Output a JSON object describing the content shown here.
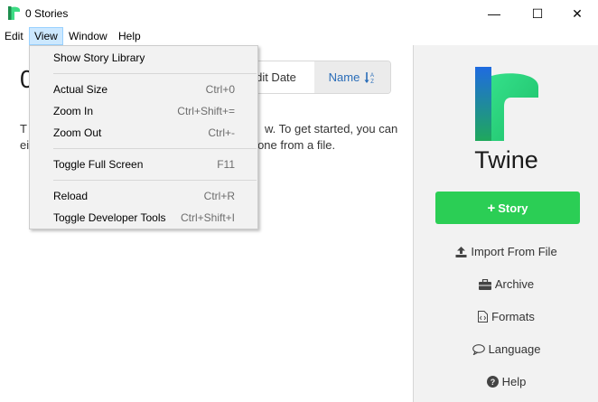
{
  "window": {
    "title": "0 Stories",
    "minimize_glyph": "—",
    "maximize_glyph": "☐",
    "close_glyph": "✕"
  },
  "menubar": {
    "items": [
      "Edit",
      "View",
      "Window",
      "Help"
    ]
  },
  "view_menu": {
    "items": [
      {
        "label": "Show Story Library",
        "accel": ""
      },
      {
        "label": "Actual Size",
        "accel": "Ctrl+0"
      },
      {
        "label": "Zoom In",
        "accel": "Ctrl+Shift+="
      },
      {
        "label": "Zoom Out",
        "accel": "Ctrl+-"
      },
      {
        "label": "Toggle Full Screen",
        "accel": "F11"
      },
      {
        "label": "Reload",
        "accel": "Ctrl+R"
      },
      {
        "label": "Toggle Developer Tools",
        "accel": "Ctrl+Shift+I"
      }
    ]
  },
  "main": {
    "title_fragment": "0",
    "sort_edit_fragment": "dit Date",
    "sort_name_label": "Name",
    "intro_line1_left": "T",
    "intro_line1_right": "w. To get started, you can",
    "intro_line2_left": "ei",
    "intro_line2_right": "ng one from a file."
  },
  "sidebar": {
    "brand": "Twine",
    "story_button": "Story",
    "story_plus": "+",
    "import": "Import From File",
    "archive": "Archive",
    "formats": "Formats",
    "language": "Language",
    "help": "Help"
  },
  "colors": {
    "accent_green": "#2bce55",
    "sort_active_text": "#2a6db8",
    "menu_highlight": "#cce8ff"
  },
  "icons": {
    "app": "twine-logo-icon",
    "sort": "sort-alpha-icon",
    "import": "upload-icon",
    "archive": "briefcase-icon",
    "formats": "file-code-icon",
    "language": "comment-icon",
    "help": "question-circle-icon"
  }
}
